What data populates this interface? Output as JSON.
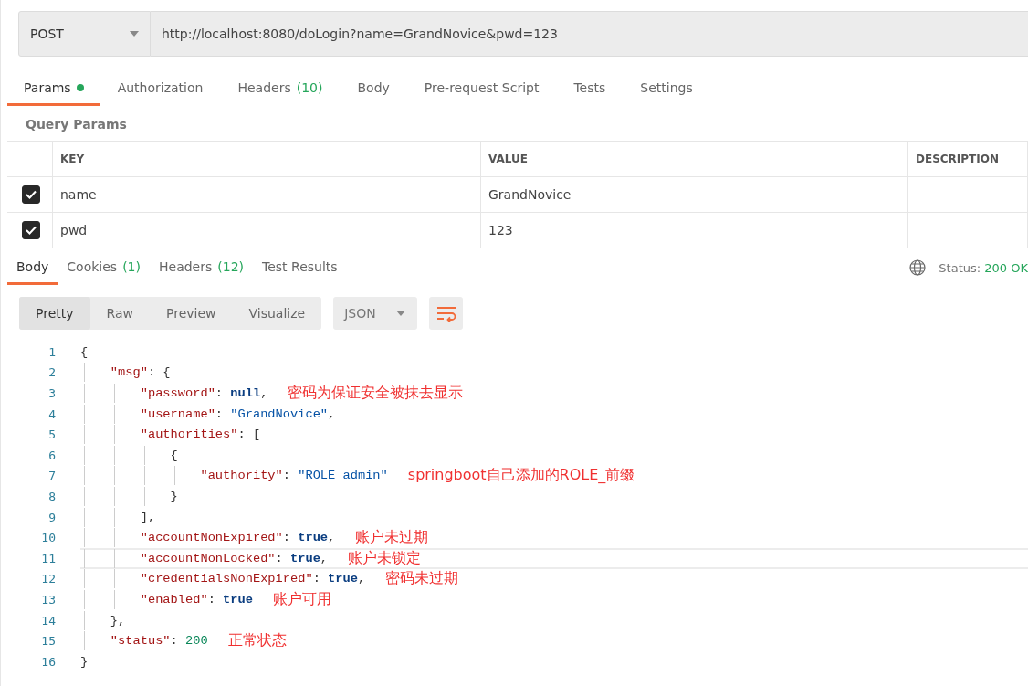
{
  "request": {
    "method": "POST",
    "url": "http://localhost:8080/doLogin?name=GrandNovice&pwd=123"
  },
  "request_tabs": [
    {
      "label": "Params",
      "dot": true,
      "selected": true
    },
    {
      "label": "Authorization",
      "dot": false,
      "selected": false
    },
    {
      "label": "Headers",
      "count": "(10)",
      "dot": false,
      "selected": false
    },
    {
      "label": "Body",
      "dot": false,
      "selected": false
    },
    {
      "label": "Pre-request Script",
      "dot": false,
      "selected": false
    },
    {
      "label": "Tests",
      "dot": false,
      "selected": false
    },
    {
      "label": "Settings",
      "dot": false,
      "selected": false
    }
  ],
  "query_params": {
    "title": "Query Params",
    "columns": [
      "KEY",
      "VALUE",
      "DESCRIPTION"
    ],
    "rows": [
      {
        "checked": true,
        "key": "name",
        "value": "GrandNovice"
      },
      {
        "checked": true,
        "key": "pwd",
        "value": "123"
      }
    ]
  },
  "response_tabs": [
    {
      "label": "Body",
      "selected": true
    },
    {
      "label": "Cookies",
      "count": "(1)",
      "selected": false
    },
    {
      "label": "Headers",
      "count": "(12)",
      "selected": false
    },
    {
      "label": "Test Results",
      "selected": false
    }
  ],
  "status": {
    "label": "Status:",
    "value": "200 OK"
  },
  "view_modes": [
    {
      "label": "Pretty",
      "selected": true
    },
    {
      "label": "Raw",
      "selected": false
    },
    {
      "label": "Preview",
      "selected": false
    },
    {
      "label": "Visualize",
      "selected": false
    }
  ],
  "format": "JSON",
  "code_lines": [
    {
      "number": "1",
      "highlighted": false,
      "tokens": [
        {
          "text": "{",
          "kind": "punct"
        }
      ]
    },
    {
      "number": "2",
      "highlighted": false,
      "tokens": [
        {
          "text": "    \"msg\"",
          "kind": "key"
        },
        {
          "text": ": {",
          "kind": "punct"
        }
      ]
    },
    {
      "number": "3",
      "highlighted": false,
      "tokens": [
        {
          "text": "        \"password\"",
          "kind": "key"
        },
        {
          "text": ": ",
          "kind": "punct"
        },
        {
          "text": "null",
          "kind": "keyword"
        },
        {
          "text": ",",
          "kind": "punct"
        }
      ],
      "note": "密码为保证安全被抹去显示"
    },
    {
      "number": "4",
      "highlighted": false,
      "tokens": [
        {
          "text": "        \"username\"",
          "kind": "key"
        },
        {
          "text": ": ",
          "kind": "punct"
        },
        {
          "text": "\"GrandNovice\"",
          "kind": "string"
        },
        {
          "text": ",",
          "kind": "punct"
        }
      ]
    },
    {
      "number": "5",
      "highlighted": false,
      "tokens": [
        {
          "text": "        \"authorities\"",
          "kind": "key"
        },
        {
          "text": ": [",
          "kind": "punct"
        }
      ]
    },
    {
      "number": "6",
      "highlighted": false,
      "tokens": [
        {
          "text": "            {",
          "kind": "punct"
        }
      ]
    },
    {
      "number": "7",
      "highlighted": false,
      "tokens": [
        {
          "text": "                \"authority\"",
          "kind": "key"
        },
        {
          "text": ": ",
          "kind": "punct"
        },
        {
          "text": "\"ROLE_admin\"",
          "kind": "string"
        }
      ],
      "note": "springboot自己添加的ROLE_前缀"
    },
    {
      "number": "8",
      "highlighted": false,
      "tokens": [
        {
          "text": "            }",
          "kind": "punct"
        }
      ]
    },
    {
      "number": "9",
      "highlighted": false,
      "tokens": [
        {
          "text": "        ],",
          "kind": "punct"
        }
      ]
    },
    {
      "number": "10",
      "highlighted": false,
      "tokens": [
        {
          "text": "        \"accountNonExpired\"",
          "kind": "key"
        },
        {
          "text": ": ",
          "kind": "punct"
        },
        {
          "text": "true",
          "kind": "keyword"
        },
        {
          "text": ",",
          "kind": "punct"
        }
      ],
      "note": "账户未过期"
    },
    {
      "number": "11",
      "highlighted": true,
      "tokens": [
        {
          "text": "        \"accountNonLocked\"",
          "kind": "key"
        },
        {
          "text": ": ",
          "kind": "punct"
        },
        {
          "text": "true",
          "kind": "keyword"
        },
        {
          "text": ",",
          "kind": "punct"
        }
      ],
      "note": "账户未锁定"
    },
    {
      "number": "12",
      "highlighted": false,
      "tokens": [
        {
          "text": "        \"credentialsNonExpired\"",
          "kind": "key"
        },
        {
          "text": ": ",
          "kind": "punct"
        },
        {
          "text": "true",
          "kind": "keyword"
        },
        {
          "text": ",",
          "kind": "punct"
        }
      ],
      "note": "密码未过期"
    },
    {
      "number": "13",
      "highlighted": false,
      "tokens": [
        {
          "text": "        \"enabled\"",
          "kind": "key"
        },
        {
          "text": ": ",
          "kind": "punct"
        },
        {
          "text": "true",
          "kind": "keyword"
        }
      ],
      "note": "账户可用"
    },
    {
      "number": "14",
      "highlighted": false,
      "tokens": [
        {
          "text": "    },",
          "kind": "punct"
        }
      ]
    },
    {
      "number": "15",
      "highlighted": false,
      "tokens": [
        {
          "text": "    \"status\"",
          "kind": "key"
        },
        {
          "text": ": ",
          "kind": "punct"
        },
        {
          "text": "200",
          "kind": "number"
        }
      ],
      "note": "正常状态"
    },
    {
      "number": "16",
      "highlighted": false,
      "tokens": [
        {
          "text": "}",
          "kind": "punct"
        }
      ]
    }
  ]
}
